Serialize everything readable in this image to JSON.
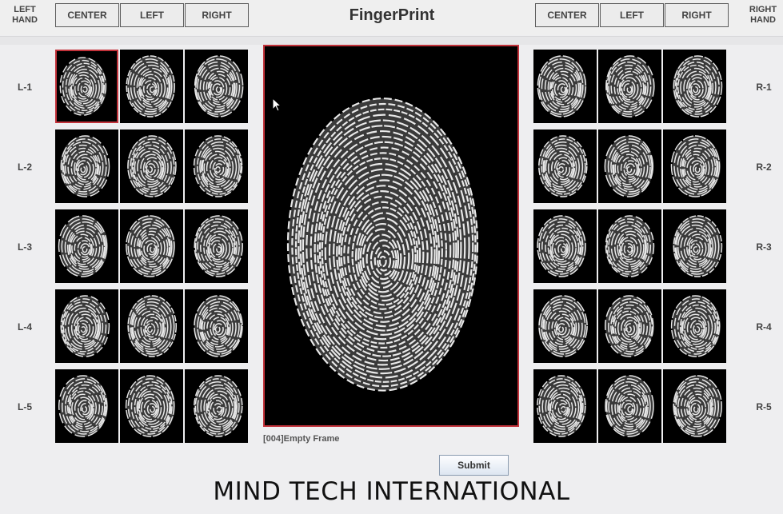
{
  "header": {
    "title": "FingerPrint",
    "left_hand_label": "LEFT\nHAND",
    "right_hand_label": "RIGHT\nHAND",
    "left_buttons": [
      "CENTER",
      "LEFT",
      "RIGHT"
    ],
    "right_buttons": [
      "CENTER",
      "LEFT",
      "RIGHT"
    ]
  },
  "left_rows": [
    "L-1",
    "L-2",
    "L-3",
    "L-4",
    "L-5"
  ],
  "right_rows": [
    "R-1",
    "R-2",
    "R-3",
    "R-4",
    "R-5"
  ],
  "selected_thumb": "L-1 CENTER",
  "status_text": "[004]Empty Frame",
  "submit_label": "Submit",
  "brand_text": "MIND TECH INTERNATIONAL",
  "colors": {
    "selection_border": "#c2323a",
    "background": "#eeeef0"
  }
}
